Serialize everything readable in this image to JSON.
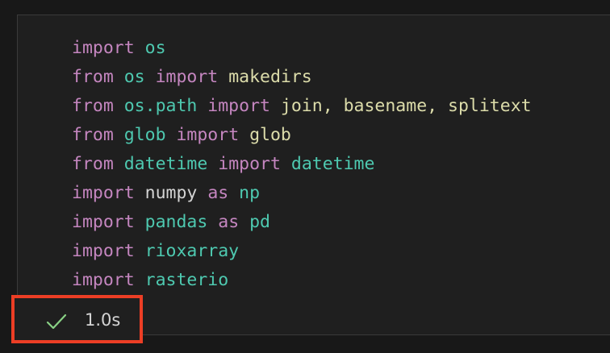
{
  "cell": {
    "lines": [
      [
        {
          "t": "import",
          "k": "kw"
        },
        {
          "t": " "
        },
        {
          "t": "os",
          "k": "mod"
        }
      ],
      [
        {
          "t": "from",
          "k": "kw"
        },
        {
          "t": " "
        },
        {
          "t": "os",
          "k": "mod"
        },
        {
          "t": " "
        },
        {
          "t": "import",
          "k": "kw"
        },
        {
          "t": " "
        },
        {
          "t": "makedirs",
          "k": "fn"
        }
      ],
      [
        {
          "t": "from",
          "k": "kw"
        },
        {
          "t": " "
        },
        {
          "t": "os.path",
          "k": "mod"
        },
        {
          "t": " "
        },
        {
          "t": "import",
          "k": "kw"
        },
        {
          "t": " "
        },
        {
          "t": "join, basename, splitext",
          "k": "fn"
        }
      ],
      [
        {
          "t": "from",
          "k": "kw"
        },
        {
          "t": " "
        },
        {
          "t": "glob",
          "k": "mod"
        },
        {
          "t": " "
        },
        {
          "t": "import",
          "k": "kw"
        },
        {
          "t": " "
        },
        {
          "t": "glob",
          "k": "fn"
        }
      ],
      [
        {
          "t": "from",
          "k": "kw"
        },
        {
          "t": " "
        },
        {
          "t": "datetime",
          "k": "mod"
        },
        {
          "t": " "
        },
        {
          "t": "import",
          "k": "kw"
        },
        {
          "t": " "
        },
        {
          "t": "datetime",
          "k": "mod"
        }
      ],
      [
        {
          "t": "import",
          "k": "kw"
        },
        {
          "t": " "
        },
        {
          "t": "numpy",
          "k": "var"
        },
        {
          "t": " "
        },
        {
          "t": "as",
          "k": "kw"
        },
        {
          "t": " "
        },
        {
          "t": "np",
          "k": "mod"
        }
      ],
      [
        {
          "t": "import",
          "k": "kw"
        },
        {
          "t": " "
        },
        {
          "t": "pandas",
          "k": "mod"
        },
        {
          "t": " "
        },
        {
          "t": "as",
          "k": "kw"
        },
        {
          "t": " "
        },
        {
          "t": "pd",
          "k": "mod"
        }
      ],
      [
        {
          "t": "import",
          "k": "kw"
        },
        {
          "t": " "
        },
        {
          "t": "rioxarray",
          "k": "mod"
        }
      ],
      [
        {
          "t": "import",
          "k": "kw"
        },
        {
          "t": " "
        },
        {
          "t": "rasterio",
          "k": "mod"
        }
      ]
    ]
  },
  "status": {
    "icon": "checkmark-icon",
    "time": "1.0s",
    "check_color": "#89d185",
    "highlight_color": "#ec3e25"
  }
}
